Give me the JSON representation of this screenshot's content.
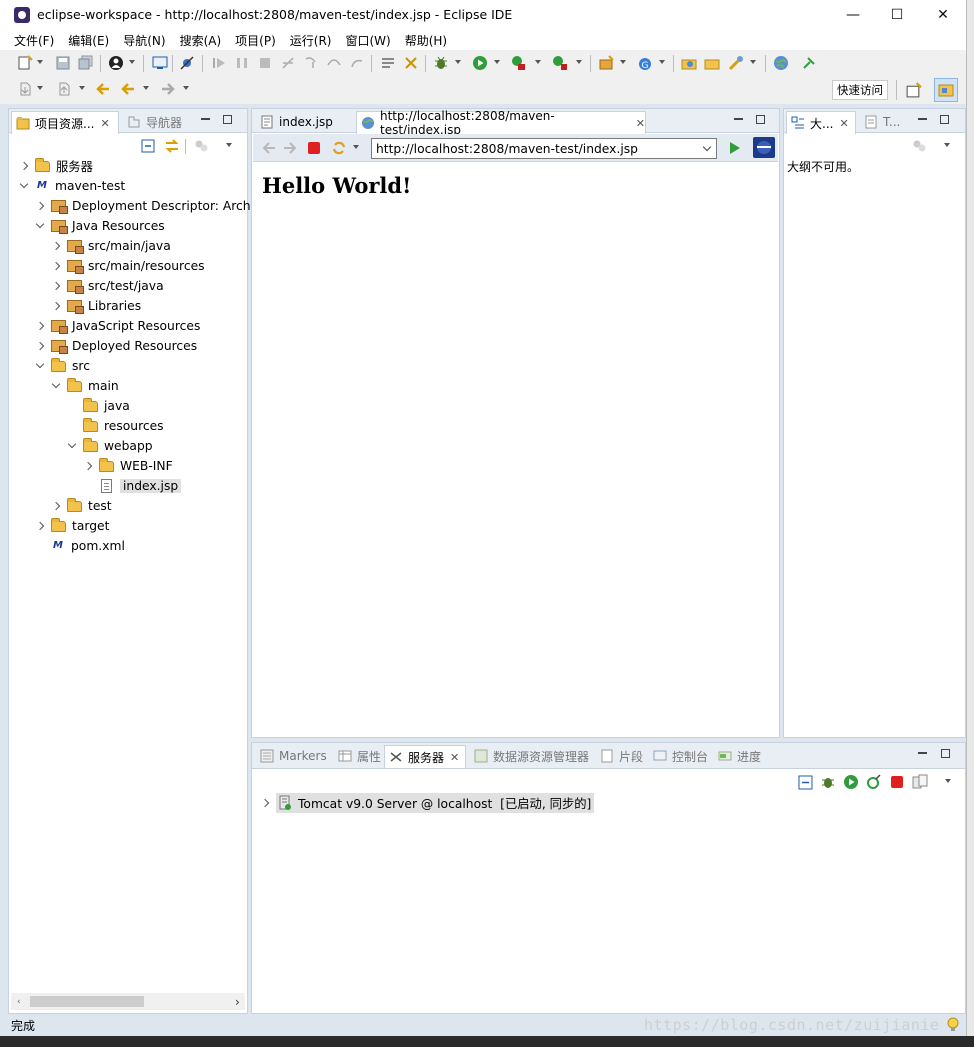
{
  "window": {
    "title": "eclipse-workspace - http://localhost:2808/maven-test/index.jsp - Eclipse IDE",
    "minimize": "—",
    "maximize": "☐",
    "close": "✕"
  },
  "menu": [
    "文件(F)",
    "编辑(E)",
    "导航(N)",
    "搜索(A)",
    "项目(P)",
    "运行(R)",
    "窗口(W)",
    "帮助(H)"
  ],
  "toolbar": {
    "quick_access": "快速访问"
  },
  "left_panel": {
    "tabs": [
      {
        "label": "项目资源..."
      },
      {
        "label": "导航器"
      }
    ],
    "tree": [
      {
        "label": "服务器",
        "chevron": "right",
        "icon": "server-folder-icon"
      },
      {
        "label": "maven-test",
        "chevron": "down",
        "icon": "maven-project-icon"
      },
      {
        "label": "Deployment Descriptor: Arche",
        "chevron": "right",
        "icon": "deployment-descriptor-icon"
      },
      {
        "label": "Java Resources",
        "chevron": "down",
        "icon": "java-resources-icon"
      },
      {
        "label": "src/main/java",
        "chevron": "right",
        "icon": "source-folder-icon"
      },
      {
        "label": "src/main/resources",
        "chevron": "right",
        "icon": "source-folder-icon"
      },
      {
        "label": "src/test/java",
        "chevron": "right",
        "icon": "source-folder-icon"
      },
      {
        "label": "Libraries",
        "chevron": "right",
        "icon": "libraries-icon"
      },
      {
        "label": "JavaScript Resources",
        "chevron": "right",
        "icon": "javascript-resources-icon"
      },
      {
        "label": "Deployed Resources",
        "chevron": "right",
        "icon": "deployed-resources-icon"
      },
      {
        "label": "src",
        "chevron": "down",
        "icon": "folder-icon"
      },
      {
        "label": "main",
        "chevron": "down",
        "icon": "folder-icon"
      },
      {
        "label": "java",
        "chevron": "none",
        "icon": "folder-icon"
      },
      {
        "label": "resources",
        "chevron": "none",
        "icon": "folder-icon"
      },
      {
        "label": "webapp",
        "chevron": "down",
        "icon": "folder-icon"
      },
      {
        "label": "WEB-INF",
        "chevron": "right",
        "icon": "folder-icon"
      },
      {
        "label": "index.jsp",
        "chevron": "none",
        "icon": "jsp-file-icon",
        "selected": true
      },
      {
        "label": "test",
        "chevron": "right",
        "icon": "folder-icon"
      },
      {
        "label": "target",
        "chevron": "right",
        "icon": "folder-icon"
      },
      {
        "label": "pom.xml",
        "chevron": "none",
        "icon": "maven-file-icon"
      }
    ]
  },
  "editor": {
    "tabs": [
      {
        "label": "index.jsp"
      },
      {
        "label": "http://localhost:2808/maven-test/index.jsp"
      }
    ],
    "url": "http://localhost:2808/maven-test/index.jsp",
    "content_heading": "Hello World!"
  },
  "outline": {
    "tabs": [
      {
        "label": "大..."
      },
      {
        "label": "T..."
      }
    ],
    "message": "大纲不可用。"
  },
  "bottom_panel": {
    "tabs": [
      {
        "label": "Markers"
      },
      {
        "label": "属性"
      },
      {
        "label": "服务器"
      },
      {
        "label": "数据源资源管理器"
      },
      {
        "label": "片段"
      },
      {
        "label": "控制台"
      },
      {
        "label": "进度"
      }
    ],
    "server_row": "Tomcat v9.0 Server @ localhost  [已启动, 同步的]"
  },
  "status": {
    "text": "完成",
    "watermark": "https://blog.csdn.net/zuijianie"
  },
  "colors": {
    "frame": "#dde6ef",
    "tab_bar": "#e9eef4",
    "border": "#c7d2de",
    "run_green": "#2e9d3a",
    "stop_red": "#e02020"
  }
}
